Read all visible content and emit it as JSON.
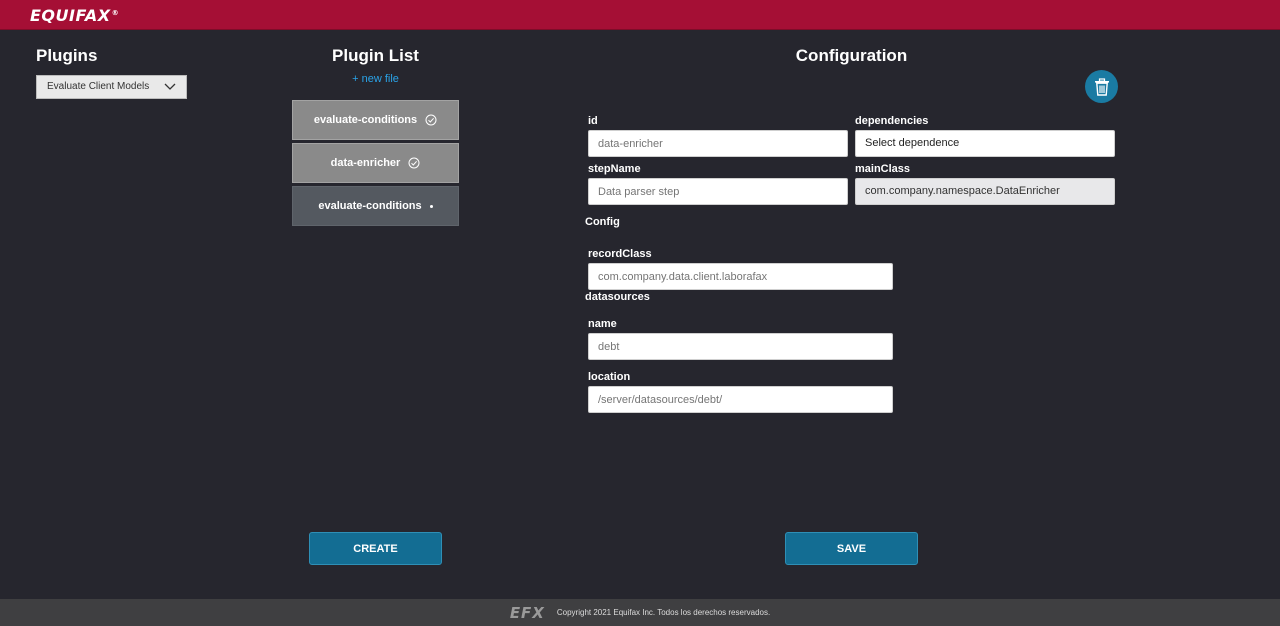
{
  "header": {
    "logo_text": "EQUIFAX",
    "logo_mark": "®",
    "brand_color": "#a50f35"
  },
  "plugins": {
    "title": "Plugins",
    "select": {
      "value": "Evaluate Client Models",
      "icon": "chevron-down-icon"
    }
  },
  "plugin_list": {
    "title": "Plugin List",
    "new_file_label": "+ new file",
    "items": [
      {
        "label": "evaluate-conditions",
        "status_icon": "check-circle-icon"
      },
      {
        "label": "data-enricher",
        "status_icon": "check-circle-icon"
      },
      {
        "label": "evaluate-conditions",
        "status_icon": "dot-icon",
        "active": true
      }
    ],
    "create_label": "CREATE"
  },
  "configuration": {
    "title": "Configuration",
    "delete_icon": "trash-icon",
    "fields": {
      "id": {
        "label": "id",
        "placeholder": "data-enricher"
      },
      "dependencies": {
        "label": "dependencies",
        "value": "Select dependence"
      },
      "stepName": {
        "label": "stepName",
        "placeholder": "Data parser step"
      },
      "mainClass": {
        "label": "mainClass",
        "value": "com.company.namespace.DataEnricher"
      }
    },
    "config_heading": "Config",
    "recordClass": {
      "label": "recordClass",
      "placeholder": "com.company.data.client.laborafax"
    },
    "datasources_heading": "datasources",
    "name": {
      "label": "name",
      "placeholder": "debt"
    },
    "location": {
      "label": "location",
      "placeholder": "/server/datasources/debt/"
    },
    "save_label": "SAVE"
  },
  "footer": {
    "logo_text": "EFX",
    "copyright": "Copyright 2021 Equifax Inc. Todos los derechos reservados."
  }
}
